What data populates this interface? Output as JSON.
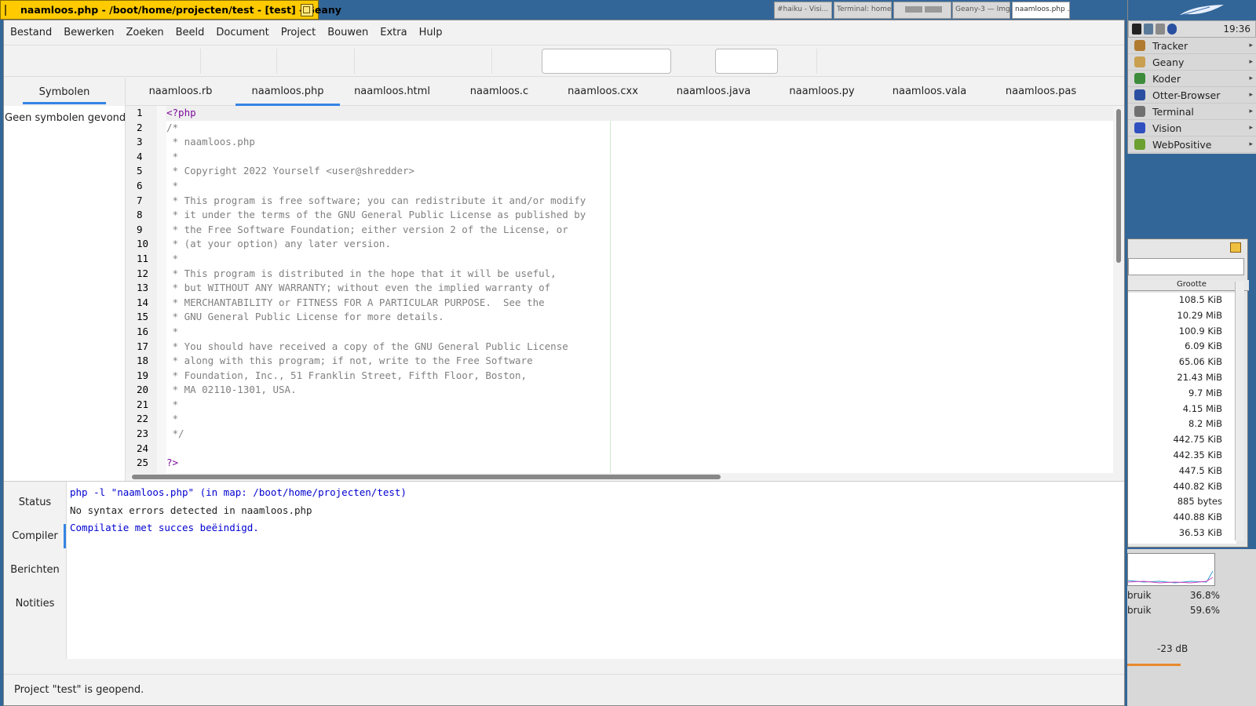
{
  "window": {
    "title": "naamloos.php - /boot/home/projecten/test - [test] - Geany"
  },
  "taskbar": {
    "items": [
      "#haiku - Visi...",
      "Terminal: home...",
      "",
      "",
      "Geany-3 — Img...",
      "naamloos.php ..."
    ]
  },
  "menu": {
    "items": [
      "Bestand",
      "Bewerken",
      "Zoeken",
      "Beeld",
      "Document",
      "Project",
      "Bouwen",
      "Extra",
      "Hulp"
    ]
  },
  "sidebar": {
    "tab": "Symbolen",
    "empty_text": "Geen symbolen gevonden"
  },
  "doc_tabs": [
    "naamloos.rb",
    "naamloos.php",
    "naamloos.html",
    "naamloos.c",
    "naamloos.cxx",
    "naamloos.java",
    "naamloos.py",
    "naamloos.vala",
    "naamloos.pas"
  ],
  "active_doc_tab": 1,
  "editor": {
    "line_numbers": [
      "1",
      "2",
      "3",
      "4",
      "5",
      "6",
      "7",
      "8",
      "9",
      "10",
      "11",
      "12",
      "13",
      "14",
      "15",
      "16",
      "17",
      "18",
      "19",
      "20",
      "21",
      "22",
      "23",
      "24",
      "25"
    ],
    "lines": [
      "<?php",
      "/*",
      " * naamloos.php",
      " *",
      " * Copyright 2022 Yourself <user@shredder>",
      " *",
      " * This program is free software; you can redistribute it and/or modify",
      " * it under the terms of the GNU General Public License as published by",
      " * the Free Software Foundation; either version 2 of the License, or",
      " * (at your option) any later version.",
      " *",
      " * This program is distributed in the hope that it will be useful,",
      " * but WITHOUT ANY WARRANTY; without even the implied warranty of",
      " * MERCHANTABILITY or FITNESS FOR A PARTICULAR PURPOSE.  See the",
      " * GNU General Public License for more details.",
      " *",
      " * You should have received a copy of the GNU General Public License",
      " * along with this program; if not, write to the Free Software",
      " * Foundation, Inc., 51 Franklin Street, Fifth Floor, Boston,",
      " * MA 02110-1301, USA.",
      " *",
      " *",
      " */",
      "",
      "?>"
    ]
  },
  "message_tabs": [
    "Status",
    "Compiler",
    "Berichten",
    "Notities"
  ],
  "active_message_tab": 1,
  "compiler_output": [
    "php -l \"naamloos.php\" (in map: /boot/home/projecten/test)",
    "No syntax errors detected in naamloos.php",
    "Compilatie met succes beëindigd."
  ],
  "statusbar": {
    "text": "Project \"test\" is geopend."
  },
  "deskbar": {
    "clock": "19:36",
    "apps": [
      {
        "label": "Tracker",
        "icon": "tracker-icon",
        "color": "#b07a30"
      },
      {
        "label": "Geany",
        "icon": "geany-icon",
        "color": "#c8a050"
      },
      {
        "label": "Koder",
        "icon": "koder-icon",
        "color": "#3c8c3c"
      },
      {
        "label": "Otter-Browser",
        "icon": "otter-icon",
        "color": "#2a4fa0"
      },
      {
        "label": "Terminal",
        "icon": "terminal-icon",
        "color": "#707070"
      },
      {
        "label": "Vision",
        "icon": "vision-icon",
        "color": "#3050c0"
      },
      {
        "label": "WebPositive",
        "icon": "webpositive-icon",
        "color": "#6ca030"
      }
    ]
  },
  "tracker_window": {
    "column": "Grootte",
    "sizes": [
      "108.5 KiB",
      "10.29 MiB",
      "100.9 KiB",
      "6.09 KiB",
      "65.06 KiB",
      "21.43 MiB",
      "9.7 MiB",
      "4.15 MiB",
      "8.2 MiB",
      "442.75 KiB",
      "442.35 KiB",
      "447.5 KiB",
      "440.82 KiB",
      "885 bytes",
      "440.88 KiB",
      "36.53 KiB"
    ]
  },
  "pulse_window": {
    "rows": [
      {
        "label": "bruik",
        "value": "36.8%"
      },
      {
        "label": "bruik",
        "value": "59.6%"
      }
    ],
    "volume": "-23 dB"
  },
  "colors": {
    "accent": "#3584e4",
    "title_tab": "#ffcb00",
    "desktop": "#336698",
    "php_tag": "#7d0b9c",
    "comment": "#808080",
    "compiler_blue": "#0000d0"
  }
}
